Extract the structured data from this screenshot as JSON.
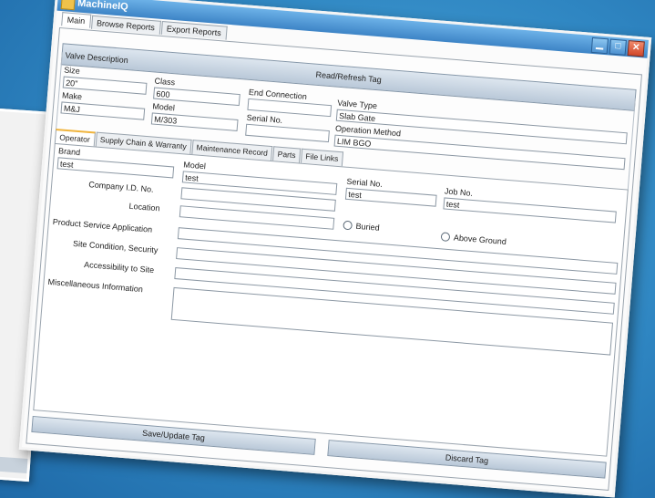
{
  "window": {
    "title": "MachineIQ",
    "controls": {
      "minimize": "▁",
      "maximize": "□",
      "close": "✕"
    }
  },
  "tabs": [
    {
      "label": "Main",
      "active": true
    },
    {
      "label": "Browse Reports",
      "active": false
    },
    {
      "label": "Export Reports",
      "active": false
    }
  ],
  "read_button": "Read/Refresh Tag",
  "valve": {
    "group_label": "Valve Description",
    "size_label": "Size",
    "size_value": "20\"",
    "class_label": "Class",
    "class_value": "600",
    "end_connection_label": "End Connection",
    "end_connection_value": "",
    "valve_type_label": "Valve Type",
    "valve_type_value": "Slab Gate",
    "make_label": "Make",
    "make_value": "M&J",
    "model_label": "Model",
    "model_value": "M/303",
    "serial_label": "Serial No.",
    "serial_value": "",
    "operation_method_label": "Operation Method",
    "operation_method_value": "LIM BGO"
  },
  "subtabs": [
    {
      "label": "Operator",
      "active": true
    },
    {
      "label": "Supply Chain & Warranty",
      "active": false
    },
    {
      "label": "Maintenance Record",
      "active": false
    },
    {
      "label": "Parts",
      "active": false
    },
    {
      "label": "File Links",
      "active": false
    }
  ],
  "operator": {
    "brand_label": "Brand",
    "brand_value": "test",
    "model_label": "Model",
    "model_value": "test",
    "serial_label": "Serial No.",
    "serial_value": "test",
    "job_label": "Job No.",
    "job_value": "test",
    "company_id_label": "Company I.D. No.",
    "company_id_value": "",
    "location_label": "Location",
    "location_value": "",
    "buried_label": "Buried",
    "above_ground_label": "Above Ground",
    "product_service_label": "Product Service Application",
    "product_service_value": "",
    "site_condition_label": "Site Condition, Security",
    "site_condition_value": "",
    "accessibility_label": "Accessibility to Site",
    "accessibility_value": "",
    "misc_label": "Miscellaneous Information",
    "misc_value": ""
  },
  "buttons": {
    "save": "Save/Update Tag",
    "discard": "Discard Tag"
  }
}
